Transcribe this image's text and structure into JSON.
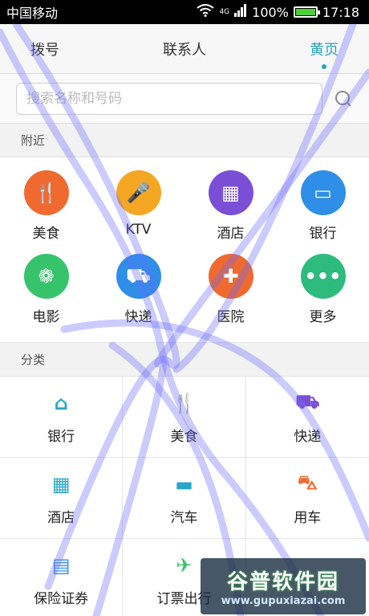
{
  "status_bar": {
    "carrier": "中国移动",
    "network": "4G",
    "battery": "100%",
    "time": "17:18"
  },
  "tabs": [
    {
      "label": "拨号",
      "active": false
    },
    {
      "label": "联系人",
      "active": false
    },
    {
      "label": "黄页",
      "active": true
    }
  ],
  "search": {
    "placeholder": "搜索名称和号码"
  },
  "nearby": {
    "title": "附近",
    "items": [
      {
        "label": "美食",
        "color": "#f06a2f",
        "glyph": "🍴"
      },
      {
        "label": "KTV",
        "color": "#f5a623",
        "glyph": "🎤"
      },
      {
        "label": "酒店",
        "color": "#7a4fd6",
        "glyph": "▦"
      },
      {
        "label": "银行",
        "color": "#2f8ee8",
        "glyph": "▭"
      },
      {
        "label": "电影",
        "color": "#36c36c",
        "glyph": "❁"
      },
      {
        "label": "快递",
        "color": "#2f8ee8",
        "glyph": "⛟"
      },
      {
        "label": "医院",
        "color": "#f06a2f",
        "glyph": "✚"
      },
      {
        "label": "更多",
        "color": "#2dbb7e",
        "glyph": "•••"
      }
    ]
  },
  "category": {
    "title": "分类",
    "items": [
      {
        "label": "银行",
        "color": "#27a7c7",
        "glyph": "⌂"
      },
      {
        "label": "美食",
        "color": "#f06a2f",
        "glyph": "🍴"
      },
      {
        "label": "快递",
        "color": "#7a4fd6",
        "glyph": "⛟"
      },
      {
        "label": "酒店",
        "color": "#27a7c7",
        "glyph": "▦"
      },
      {
        "label": "汽车",
        "color": "#27a7c7",
        "glyph": "▬"
      },
      {
        "label": "用车",
        "color": "#f06a2f",
        "glyph": "⛍"
      },
      {
        "label": "保险证券",
        "color": "#2f8ee8",
        "glyph": "▤"
      },
      {
        "label": "订票出行",
        "color": "#36c36c",
        "glyph": "✈"
      },
      {
        "label": "",
        "color": "#f06a2f",
        "glyph": ""
      }
    ]
  },
  "watermark": {
    "main": "谷普软件园",
    "url": "www.gupuxiazai.com"
  }
}
